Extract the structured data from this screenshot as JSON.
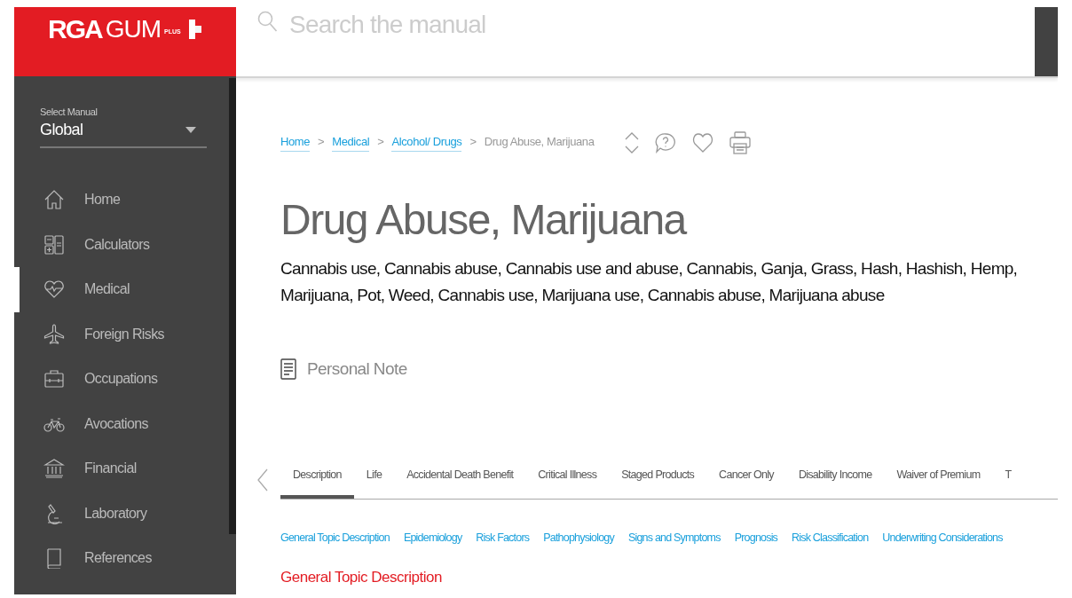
{
  "logo": {
    "brand": "RGA",
    "product": "GUM",
    "badge": "PLUS"
  },
  "search": {
    "placeholder": "Search the manual"
  },
  "sidebar": {
    "select_label": "Select Manual",
    "select_value": "Global",
    "items": [
      {
        "label": "Home",
        "kind": "home",
        "selected": false
      },
      {
        "label": "Calculators",
        "kind": "calculator",
        "selected": false
      },
      {
        "label": "Medical",
        "kind": "heart",
        "selected": true
      },
      {
        "label": "Foreign Risks",
        "kind": "plane",
        "selected": false
      },
      {
        "label": "Occupations",
        "kind": "briefcase",
        "selected": false
      },
      {
        "label": "Avocations",
        "kind": "bike",
        "selected": false
      },
      {
        "label": "Financial",
        "kind": "bank",
        "selected": false
      },
      {
        "label": "Laboratory",
        "kind": "microscope",
        "selected": false
      },
      {
        "label": "References",
        "kind": "book",
        "selected": false
      }
    ]
  },
  "breadcrumb": [
    {
      "label": "Home",
      "link": true
    },
    {
      "label": "Medical",
      "link": true
    },
    {
      "label": "Alcohol/ Drugs",
      "link": true
    },
    {
      "label": "Drug Abuse, Marijuana",
      "link": false
    }
  ],
  "breadcrumb_separator": ">",
  "title": "Drug Abuse, Marijuana",
  "synonyms": "Cannabis use, Cannabis abuse, Cannabis use and abuse, Cannabis, Ganja, Grass, Hash, Hashish, Hemp, Marijuana, Pot, Weed, Cannabis use, Marijuana use, Cannabis abuse, Marijuana abuse",
  "personal_note": "Personal Note",
  "tabs": [
    {
      "label": "Description",
      "selected": true
    },
    {
      "label": "Life",
      "selected": false
    },
    {
      "label": "Accidental Death Benefit",
      "selected": false
    },
    {
      "label": "Critical Illness",
      "selected": false
    },
    {
      "label": "Staged Products",
      "selected": false
    },
    {
      "label": "Cancer Only",
      "selected": false
    },
    {
      "label": "Disability Income",
      "selected": false
    },
    {
      "label": "Waiver of Premium",
      "selected": false
    },
    {
      "label": "T",
      "selected": false
    }
  ],
  "section_links": [
    "General Topic Description",
    "Epidemiology",
    "Risk Factors",
    "Pathophysiology",
    "Signs and Symptoms",
    "Prognosis",
    "Risk Classification",
    "Underwriting Considerations"
  ],
  "section_heading": "General Topic Description"
}
